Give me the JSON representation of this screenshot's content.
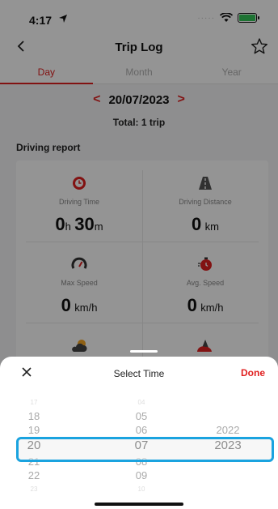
{
  "status": {
    "time": "4:17"
  },
  "nav": {
    "title": "Trip Log"
  },
  "tabs": [
    {
      "label": "Day"
    },
    {
      "label": "Month"
    },
    {
      "label": "Year"
    }
  ],
  "date": {
    "prev": "<",
    "value": "20/07/2023",
    "next": ">"
  },
  "total": "Total: 1 trip",
  "section": "Driving report",
  "report": {
    "driving_time": {
      "label": "Driving Time",
      "h_value": "0",
      "h_unit": "h",
      "m_value": "30",
      "m_unit": "m"
    },
    "driving_distance": {
      "label": "Driving Distance",
      "value": "0",
      "unit": "km"
    },
    "max_speed": {
      "label": "Max Speed",
      "value": "0",
      "unit": "km/h"
    },
    "avg_speed": {
      "label": "Avg. Speed",
      "value": "0",
      "unit": "km/h"
    }
  },
  "sheet": {
    "close": "✕",
    "title": "Select Time",
    "done": "Done"
  },
  "picker": {
    "days": [
      "17",
      "18",
      "19",
      "20",
      "21",
      "22",
      "23"
    ],
    "months": [
      "04",
      "05",
      "06",
      "07",
      "08",
      "09",
      "10"
    ],
    "years": [
      "2022",
      "2023"
    ],
    "selected": {
      "day": "20",
      "month": "07",
      "year": "2023"
    }
  },
  "colors": {
    "accent": "#e02020",
    "highlight": "#1aa3df"
  }
}
